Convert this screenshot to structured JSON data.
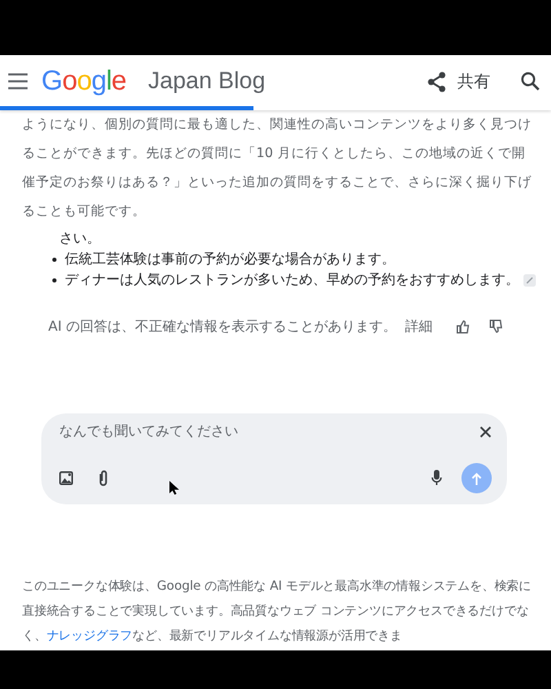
{
  "header": {
    "logo": "Google",
    "title": "Japan Blog",
    "share_label": "共有",
    "progress": {
      "level": 0.46
    }
  },
  "intro": "ようになり、個別の質問に最も適した、関連性の高いコンテンツをより多く見つけることができます。先ほどの質問に「10 月に行くとしたら、この地域の近くで開催予定のお祭りはある？」といった追加の質問をすることで、さらに深く掘り下げることも可能です。",
  "ai_answer": {
    "lead": "さい。",
    "bullets": [
      "伝統工芸体験は事前の予約が必要な場合があります。",
      "ディナーは人気のレストランが多いため、早めの予約をおすすめします。"
    ],
    "disclaimer": "AI の回答は、不正確な情報を表示することがあります。",
    "details_link": "詳細"
  },
  "ask_box": {
    "placeholder": "なんでも聞いてみてください"
  },
  "closing": {
    "text_before": "このユニークな体験は、Google の高性能な AI モデルと最高水準の情報システムを、検索に直接統合することで実現しています。高品質なウェブ コンテンツにアクセスできるだけでなく、",
    "link": "ナレッジグラフ",
    "text_after": "など、最新でリアルタイムな情報源が活用できま"
  }
}
